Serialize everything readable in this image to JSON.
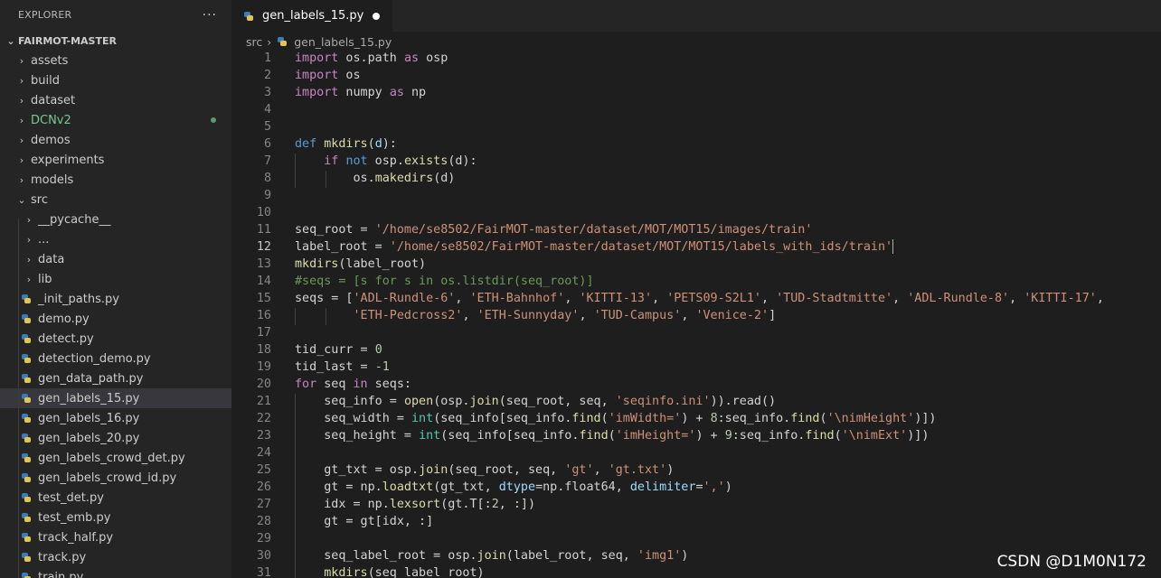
{
  "explorer": {
    "title": "EXPLORER",
    "menu": "···",
    "project": "FAIRMOT-MASTER",
    "items": [
      {
        "label": "assets",
        "kind": "folder",
        "state": "collapsed",
        "depth": 0
      },
      {
        "label": "build",
        "kind": "folder",
        "state": "collapsed",
        "depth": 0
      },
      {
        "label": "dataset",
        "kind": "folder",
        "state": "collapsed",
        "depth": 0
      },
      {
        "label": "DCNv2",
        "kind": "folder",
        "state": "collapsed",
        "depth": 0,
        "modified": true
      },
      {
        "label": "demos",
        "kind": "folder",
        "state": "collapsed",
        "depth": 0
      },
      {
        "label": "experiments",
        "kind": "folder",
        "state": "collapsed",
        "depth": 0
      },
      {
        "label": "models",
        "kind": "folder",
        "state": "collapsed",
        "depth": 0
      },
      {
        "label": "src",
        "kind": "folder",
        "state": "expanded",
        "depth": 0
      },
      {
        "label": "__pycache__",
        "kind": "folder",
        "state": "collapsed",
        "depth": 1
      },
      {
        "label": "...",
        "kind": "folder",
        "state": "collapsed",
        "depth": 1
      },
      {
        "label": "data",
        "kind": "folder",
        "state": "collapsed",
        "depth": 1
      },
      {
        "label": "lib",
        "kind": "folder",
        "state": "collapsed",
        "depth": 1
      },
      {
        "label": "_init_paths.py",
        "kind": "file",
        "depth": 1
      },
      {
        "label": "demo.py",
        "kind": "file",
        "depth": 1
      },
      {
        "label": "detect.py",
        "kind": "file",
        "depth": 1
      },
      {
        "label": "detection_demo.py",
        "kind": "file",
        "depth": 1
      },
      {
        "label": "gen_data_path.py",
        "kind": "file",
        "depth": 1
      },
      {
        "label": "gen_labels_15.py",
        "kind": "file",
        "depth": 1,
        "selected": true
      },
      {
        "label": "gen_labels_16.py",
        "kind": "file",
        "depth": 1
      },
      {
        "label": "gen_labels_20.py",
        "kind": "file",
        "depth": 1
      },
      {
        "label": "gen_labels_crowd_det.py",
        "kind": "file",
        "depth": 1
      },
      {
        "label": "gen_labels_crowd_id.py",
        "kind": "file",
        "depth": 1
      },
      {
        "label": "test_det.py",
        "kind": "file",
        "depth": 1
      },
      {
        "label": "test_emb.py",
        "kind": "file",
        "depth": 1
      },
      {
        "label": "track_half.py",
        "kind": "file",
        "depth": 1
      },
      {
        "label": "track.py",
        "kind": "file",
        "depth": 1
      },
      {
        "label": "train.py",
        "kind": "file",
        "depth": 1
      }
    ]
  },
  "editor": {
    "tab": {
      "label": "gen_labels_15.py",
      "unsaved": true
    },
    "breadcrumb": [
      "src",
      "gen_labels_15.py"
    ],
    "active_line": 12,
    "lines": [
      {
        "n": "1",
        "tokens": [
          [
            "kw",
            "import"
          ],
          [
            "var",
            " os.path "
          ],
          [
            "kw",
            "as"
          ],
          [
            "var",
            " osp"
          ]
        ]
      },
      {
        "n": "2",
        "tokens": [
          [
            "kw",
            "import"
          ],
          [
            "var",
            " os"
          ]
        ]
      },
      {
        "n": "3",
        "tokens": [
          [
            "kw",
            "import"
          ],
          [
            "var",
            " numpy "
          ],
          [
            "kw",
            "as"
          ],
          [
            "var",
            " np"
          ]
        ]
      },
      {
        "n": "4",
        "tokens": []
      },
      {
        "n": "5",
        "tokens": []
      },
      {
        "n": "6",
        "tokens": [
          [
            "def",
            "def"
          ],
          [
            "var",
            " "
          ],
          [
            "fn",
            "mkdirs"
          ],
          [
            "var",
            "("
          ],
          [
            "param",
            "d"
          ],
          [
            "var",
            "):"
          ]
        ]
      },
      {
        "n": "7",
        "tokens": [
          [
            "var",
            "    "
          ],
          [
            "kw",
            "if"
          ],
          [
            "var",
            " "
          ],
          [
            "def",
            "not"
          ],
          [
            "var",
            " osp."
          ],
          [
            "fn",
            "exists"
          ],
          [
            "var",
            "(d):"
          ]
        ]
      },
      {
        "n": "8",
        "tokens": [
          [
            "var",
            "        os."
          ],
          [
            "fn",
            "makedirs"
          ],
          [
            "var",
            "(d)"
          ]
        ]
      },
      {
        "n": "9",
        "tokens": []
      },
      {
        "n": "10",
        "tokens": []
      },
      {
        "n": "11",
        "tokens": [
          [
            "var",
            "seq_root = "
          ],
          [
            "str",
            "'/home/se8502/FairMOT-master/dataset/MOT/MOT15/images/train'"
          ]
        ]
      },
      {
        "n": "12",
        "tokens": [
          [
            "var",
            "label_root = "
          ],
          [
            "str",
            "'/home/se8502/FairMOT-master/dataset/MOT/MOT15/labels_with_ids/train'"
          ]
        ],
        "cursor": true
      },
      {
        "n": "13",
        "tokens": [
          [
            "fn",
            "mkdirs"
          ],
          [
            "var",
            "(label_root)"
          ]
        ]
      },
      {
        "n": "14",
        "tokens": [
          [
            "cmt",
            "#seqs = [s for s in os.listdir(seq_root)]"
          ]
        ]
      },
      {
        "n": "15",
        "tokens": [
          [
            "var",
            "seqs = ["
          ],
          [
            "str",
            "'ADL-Rundle-6'"
          ],
          [
            "var",
            ", "
          ],
          [
            "str",
            "'ETH-Bahnhof'"
          ],
          [
            "var",
            ", "
          ],
          [
            "str",
            "'KITTI-13'"
          ],
          [
            "var",
            ", "
          ],
          [
            "str",
            "'PETS09-S2L1'"
          ],
          [
            "var",
            ", "
          ],
          [
            "str",
            "'TUD-Stadtmitte'"
          ],
          [
            "var",
            ", "
          ],
          [
            "str",
            "'ADL-Rundle-8'"
          ],
          [
            "var",
            ", "
          ],
          [
            "str",
            "'KITTI-17'"
          ],
          [
            "var",
            ","
          ]
        ]
      },
      {
        "n": "16",
        "tokens": [
          [
            "var",
            "        "
          ],
          [
            "str",
            "'ETH-Pedcross2'"
          ],
          [
            "var",
            ", "
          ],
          [
            "str",
            "'ETH-Sunnyday'"
          ],
          [
            "var",
            ", "
          ],
          [
            "str",
            "'TUD-Campus'"
          ],
          [
            "var",
            ", "
          ],
          [
            "str",
            "'Venice-2'"
          ],
          [
            "var",
            "]"
          ]
        ]
      },
      {
        "n": "17",
        "tokens": []
      },
      {
        "n": "18",
        "tokens": [
          [
            "var",
            "tid_curr = "
          ],
          [
            "num",
            "0"
          ]
        ]
      },
      {
        "n": "19",
        "tokens": [
          [
            "var",
            "tid_last = "
          ],
          [
            "num",
            "-1"
          ]
        ]
      },
      {
        "n": "20",
        "tokens": [
          [
            "kw",
            "for"
          ],
          [
            "var",
            " seq "
          ],
          [
            "kw",
            "in"
          ],
          [
            "var",
            " seqs:"
          ]
        ]
      },
      {
        "n": "21",
        "tokens": [
          [
            "var",
            "    seq_info = "
          ],
          [
            "fn",
            "open"
          ],
          [
            "var",
            "(osp."
          ],
          [
            "fn",
            "join"
          ],
          [
            "var",
            "(seq_root, seq, "
          ],
          [
            "str",
            "'seqinfo.ini'"
          ],
          [
            "var",
            ")).read()"
          ]
        ]
      },
      {
        "n": "22",
        "tokens": [
          [
            "var",
            "    seq_width = "
          ],
          [
            "ty",
            "int"
          ],
          [
            "var",
            "(seq_info[seq_info."
          ],
          [
            "fn",
            "find"
          ],
          [
            "var",
            "("
          ],
          [
            "str",
            "'imWidth='"
          ],
          [
            "var",
            ") + "
          ],
          [
            "num",
            "8"
          ],
          [
            "var",
            ":seq_info."
          ],
          [
            "fn",
            "find"
          ],
          [
            "var",
            "("
          ],
          [
            "str",
            "'\\nimHeight'"
          ],
          [
            "var",
            ")])"
          ]
        ]
      },
      {
        "n": "23",
        "tokens": [
          [
            "var",
            "    seq_height = "
          ],
          [
            "ty",
            "int"
          ],
          [
            "var",
            "(seq_info[seq_info."
          ],
          [
            "fn",
            "find"
          ],
          [
            "var",
            "("
          ],
          [
            "str",
            "'imHeight='"
          ],
          [
            "var",
            ") + "
          ],
          [
            "num",
            "9"
          ],
          [
            "var",
            ":seq_info."
          ],
          [
            "fn",
            "find"
          ],
          [
            "var",
            "("
          ],
          [
            "str",
            "'\\nimExt'"
          ],
          [
            "var",
            ")])"
          ]
        ]
      },
      {
        "n": "24",
        "tokens": []
      },
      {
        "n": "25",
        "tokens": [
          [
            "var",
            "    gt_txt = osp."
          ],
          [
            "fn",
            "join"
          ],
          [
            "var",
            "(seq_root, seq, "
          ],
          [
            "str",
            "'gt'"
          ],
          [
            "var",
            ", "
          ],
          [
            "str",
            "'gt.txt'"
          ],
          [
            "var",
            ")"
          ]
        ]
      },
      {
        "n": "26",
        "tokens": [
          [
            "var",
            "    gt = np."
          ],
          [
            "fn",
            "loadtxt"
          ],
          [
            "var",
            "(gt_txt, "
          ],
          [
            "param",
            "dtype"
          ],
          [
            "var",
            "=np.float64, "
          ],
          [
            "param",
            "delimiter"
          ],
          [
            "var",
            "="
          ],
          [
            "str",
            "','"
          ],
          [
            "var",
            ")"
          ]
        ]
      },
      {
        "n": "27",
        "tokens": [
          [
            "var",
            "    idx = np."
          ],
          [
            "fn",
            "lexsort"
          ],
          [
            "var",
            "(gt.T[:"
          ],
          [
            "num",
            "2"
          ],
          [
            "var",
            ", :])"
          ]
        ]
      },
      {
        "n": "28",
        "tokens": [
          [
            "var",
            "    gt = gt[idx, :]"
          ]
        ]
      },
      {
        "n": "29",
        "tokens": []
      },
      {
        "n": "30",
        "tokens": [
          [
            "var",
            "    seq_label_root = osp."
          ],
          [
            "fn",
            "join"
          ],
          [
            "var",
            "(label_root, seq, "
          ],
          [
            "str",
            "'img1'"
          ],
          [
            "var",
            ")"
          ]
        ]
      },
      {
        "n": "31",
        "tokens": [
          [
            "var",
            "    "
          ],
          [
            "fn",
            "mkdirs"
          ],
          [
            "var",
            "(seq_label_root)"
          ]
        ]
      }
    ]
  },
  "watermark": "CSDN @D1M0N172",
  "colors": {
    "sidebar": "#252526",
    "editor": "#1e1e1e",
    "keyword": "#c586c0",
    "string": "#ce9178",
    "function": "#dcdcaa",
    "comment": "#6a9955",
    "number": "#b5cea8"
  }
}
